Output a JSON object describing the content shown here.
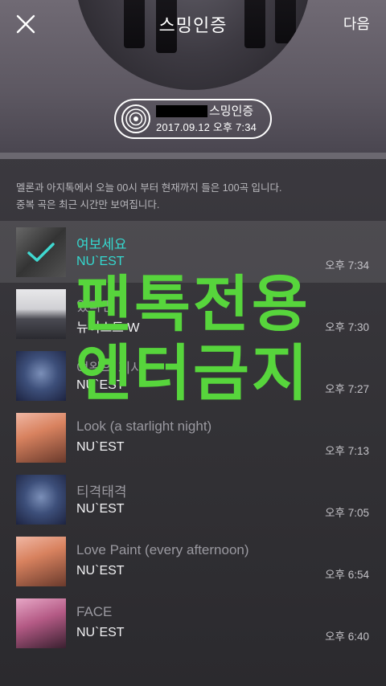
{
  "header": {
    "title": "스밍인증",
    "next_label": "다음",
    "close_icon": "close-icon"
  },
  "badge": {
    "title_suffix": "스밍인증",
    "datetime": "2017.09.12 오후 7:34",
    "icon": "vinyl-disc-icon"
  },
  "notice": {
    "line1": "멜론과 아지톡에서 오늘 00시 부터 현재까지 들은 100곡 입니다.",
    "line2": "중복 곡은 최근 시간만 보여집니다."
  },
  "songs": [
    {
      "title": "여보세요",
      "artist": "NU`EST",
      "time": "오후 7:34",
      "selected": true
    },
    {
      "title": "있다면",
      "artist": "뉴이스트 W",
      "time": "오후 7:30",
      "selected": false
    },
    {
      "title": "여왕의 기사",
      "artist": "NU`EST",
      "time": "오후 7:27",
      "selected": false
    },
    {
      "title": "Look (a starlight night)",
      "artist": "NU`EST",
      "time": "오후 7:13",
      "selected": false
    },
    {
      "title": "티격태격",
      "artist": "NU`EST",
      "time": "오후 7:05",
      "selected": false
    },
    {
      "title": "Love Paint (every afternoon)",
      "artist": "NU`EST",
      "time": "오후 6:54",
      "selected": false
    },
    {
      "title": "FACE",
      "artist": "NU`EST",
      "time": "오후 6:40",
      "selected": false
    }
  ],
  "watermark": {
    "line1": "팬톡전용",
    "line2": "엔터금지",
    "color": "#57d53c"
  },
  "colors": {
    "accent": "#35d8cf",
    "check": "#3fd8d0"
  }
}
